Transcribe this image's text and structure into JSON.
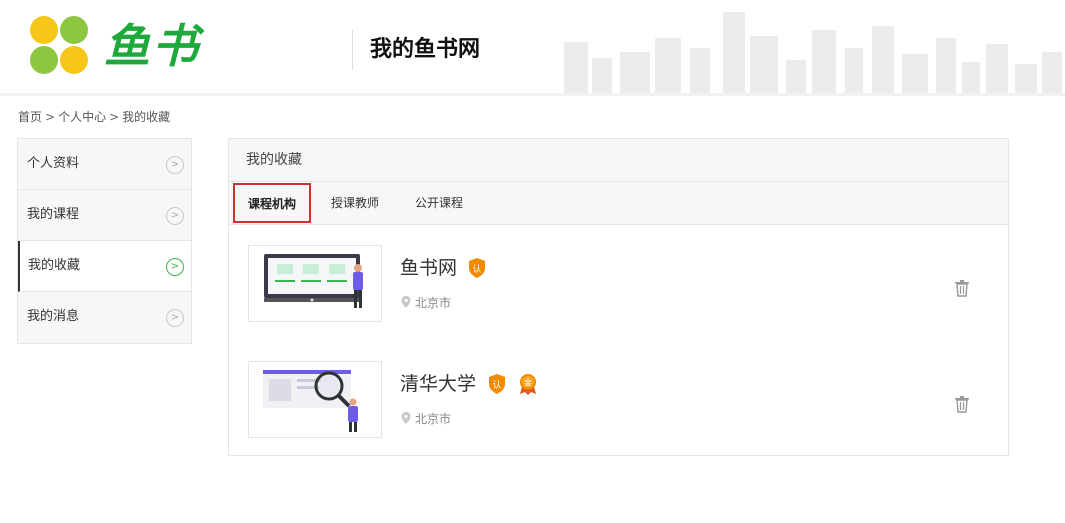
{
  "header": {
    "logo_text": "鱼书",
    "title": "我的鱼书网"
  },
  "breadcrumb": {
    "items": [
      "首页",
      "个人中心",
      "我的收藏"
    ],
    "separator": ">"
  },
  "sidebar": {
    "items": [
      {
        "label": "个人资料",
        "active": false
      },
      {
        "label": "我的课程",
        "active": false
      },
      {
        "label": "我的收藏",
        "active": true
      },
      {
        "label": "我的消息",
        "active": false
      }
    ],
    "arrow_icon": "chevron-right-circle-icon"
  },
  "panel": {
    "title": "我的收藏",
    "tabs": [
      {
        "label": "课程机构",
        "active": true
      },
      {
        "label": "授课教师",
        "active": false
      },
      {
        "label": "公开课程",
        "active": false
      }
    ]
  },
  "favorites": [
    {
      "name": "鱼书网",
      "location": "北京市",
      "badges": [
        "认"
      ]
    },
    {
      "name": "清华大学",
      "location": "北京市",
      "badges": [
        "认",
        "金"
      ]
    }
  ],
  "colors": {
    "brand_green": "#1fa93c",
    "active_tab_border": "#d32f2f",
    "badge_orange": "#f08a00",
    "active_arrow": "#3ab54a"
  }
}
